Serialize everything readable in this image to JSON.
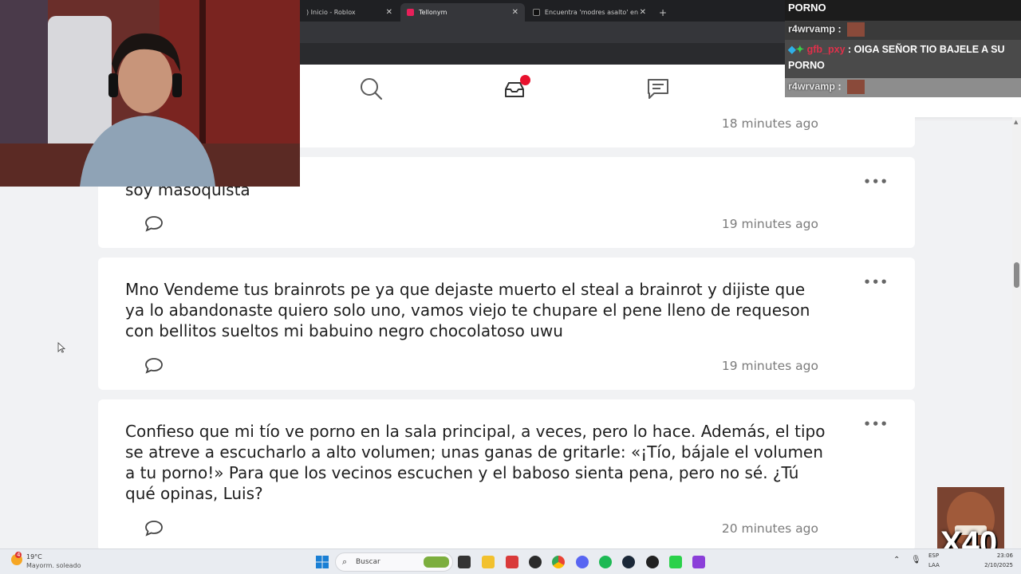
{
  "browser": {
    "tabs": [
      {
        "label": ") Inicio - Roblox",
        "active": false
      },
      {
        "label": "Tellonym",
        "active": true
      },
      {
        "label": "Encuentra 'modres asalto' en Ti",
        "active": false
      }
    ],
    "new_tab_label": "+"
  },
  "header": {
    "icons": [
      "search-icon",
      "inbox-icon",
      "messages-icon"
    ],
    "notification_color": "#e8112d"
  },
  "feed": {
    "partial_top_time": "18 minutes ago",
    "cards": [
      {
        "text": "soy masoquista",
        "time": "19 minutes ago"
      },
      {
        "text": "Mno Vendeme tus brainrots pe ya que dejaste muerto el steal a brainrot y dijiste que ya lo abandonaste quiero solo uno, vamos viejo te chupare el pene lleno de requeson con bellitos sueltos mi babuino negro chocolatoso uwu",
        "time": "19 minutes ago"
      },
      {
        "text": "Confieso que mi tío ve porno en la sala principal, a veces, pero lo hace. Además, el tipo se atreve a escucharlo a alto volumen; unas ganas de gritarle: «¡Tío, bájale el volumen a tu porno!» Para que los vecinos escuchen y el baboso sienta pena, pero no sé. ¿Tú qué opinas, Luis?",
        "time": "20 minutes ago"
      }
    ],
    "more_label": "•••"
  },
  "chat": {
    "top_line": "PORNO",
    "lines": [
      {
        "user": "r4wrvamp",
        "sep": " :",
        "message": ""
      },
      {
        "user": "gfb_pxy",
        "sep": " : ",
        "message": "OIGA SEÑOR TIO BAJELE A SU PORNO"
      },
      {
        "user": "r4wrvamp",
        "sep": " :",
        "message": ""
      }
    ]
  },
  "overlay": {
    "multiplier": "X40"
  },
  "taskbar": {
    "weather_temp": "19°C",
    "weather_desc": "Mayorm. soleado",
    "weather_badge": "4",
    "search_placeholder": "Buscar",
    "lang_top": "ESP",
    "lang_bottom": "LAA",
    "time": "23:06",
    "date": "2/10/2025"
  }
}
